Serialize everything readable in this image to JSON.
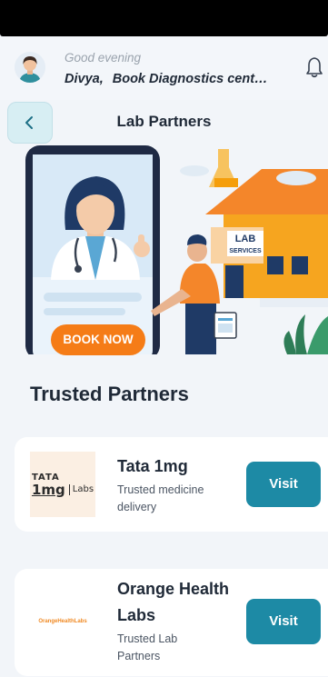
{
  "greeting": {
    "salutation": "Good evening",
    "user_name": "Divya,",
    "subtitle": "Book Diagnostics cent…"
  },
  "header": {
    "title": "Lab Partners"
  },
  "banner": {
    "button_label": "BOOK NOW",
    "sign_line1": "LAB",
    "sign_line2": "SERVICES"
  },
  "section": {
    "title": "Trusted Partners"
  },
  "partners": [
    {
      "name": "Tata 1mg",
      "description": "Trusted medicine delivery",
      "visit_label": "Visit",
      "logo": {
        "top": "TATA",
        "brand": "1mg",
        "suffix": "Labs"
      }
    },
    {
      "name": "Orange Health Labs",
      "description": "Trusted Lab Partners",
      "visit_label": "Visit",
      "logo": {
        "text": "OrangeHealthLabs"
      }
    }
  ],
  "icons": {
    "back": "chevron-left-icon",
    "notification": "bell-icon",
    "avatar": "user-avatar"
  },
  "colors": {
    "accent": "#1d8aa5",
    "book_now": "#f57c17",
    "background": "#f2f5f9"
  }
}
